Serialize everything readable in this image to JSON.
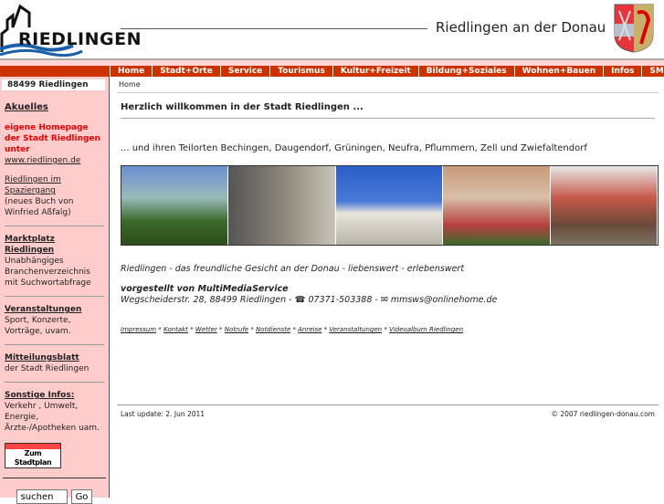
{
  "header": {
    "logo_text": "RIEDLINGEN",
    "title": "Riedlingen an der Donau",
    "crest": "coat-of-arms"
  },
  "nav": [
    "Home",
    "Stadt+Orte",
    "Service",
    "Tourismus",
    "Kultur+Freizeit",
    "Bildung+Soziales",
    "Wohnen+Bauen",
    "Infos",
    "SM"
  ],
  "sidebar": {
    "zip": "88499 Riedlingen",
    "aktuelles": "Akuelles",
    "homepage_note": "eigene Homepage der Stadt Riedlingen unter",
    "homepage_link": "www.riedlingen.de",
    "spaziergang_link": "Riedlingen im Spaziergang",
    "spaziergang_note": "(neues Buch von Winfried Aßfalg)",
    "marktplatz": "Marktplatz Riedlingen",
    "marktplatz_desc": "Unabhängiges Branchenverzeichnis mit Suchwortabfrage",
    "veranstaltungen": "Veranstaltungen",
    "veranstaltungen_desc": "Sport, Konzerte, Vorträge, uvam.",
    "mitteilungsblatt": "Mitteilungsblatt",
    "mitteilungsblatt_desc": "der Stadt Riedlingen",
    "sonstige": "Sonstige Infos:",
    "sonstige_desc": "Verkehr , Umwelt, Energie, Ärzte-/Apotheken uam.",
    "stadtplan": "Zum Stadtplan",
    "search_value": "suchen",
    "go": "Go"
  },
  "main": {
    "breadcrumb": "Home",
    "welcome": "Herzlich willkommen in der Stadt Riedlingen ...",
    "teilorte": "... und ihren Teilorten Bechingen, Daugendorf, Grüningen, Neufra, Pflummern, Zell und Zwiefaltendorf",
    "slogan": "Riedlingen - das freundliche Gesicht an der Donau - liebenswert - erlebenswert",
    "presented_by": "vorgestellt von MultiMediaService",
    "address": "Wegscheiderstr. 28, 88499 Riedlingen - ☎ 07371-503388 - ✉ ",
    "email": "mmsws@onlinehome.de",
    "links": [
      "Impressum",
      "Kontakt",
      "Wetter",
      "Notrufe",
      "Notdienste",
      "Anreise",
      "Veranstaltungen",
      "Videoalbum Riedlingen"
    ]
  },
  "footer": {
    "updated": "Last update: 2. Jun 2011",
    "copyright": "© 2007 riedlingen-donau.com"
  }
}
